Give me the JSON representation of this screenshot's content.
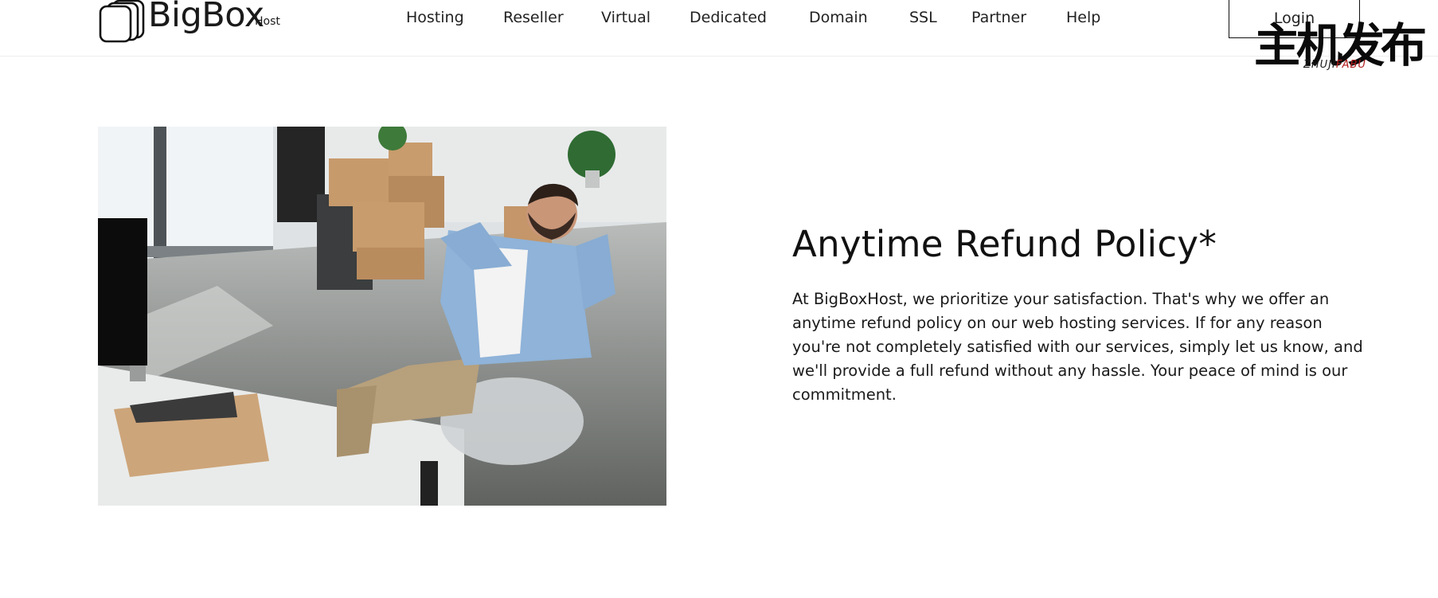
{
  "header": {
    "logo": {
      "name": "BigBox",
      "suffix": "Host",
      "icon": "stacked-boxes-logo"
    },
    "nav": [
      "Hosting",
      "Reseller",
      "Virtual",
      "Dedicated",
      "Domain",
      "SSL",
      "Partner",
      "Help"
    ],
    "login_label": "Login"
  },
  "watermark": {
    "han": "主机发布",
    "latin_prefix": "ZHUJI",
    "latin_accent": "FABU"
  },
  "hero": {
    "image": "man-relaxing-office-chair-photo",
    "title": "Anytime Refund Policy*",
    "description": "At BigBoxHost, we prioritize your satisfaction. That's why we offer an anytime refund policy on our web hosting services. If for any reason you're not completely satisfied with our services, simply let us know, and we'll provide a full refund without any hassle. Your peace of mind is our commitment."
  },
  "colors": {
    "text": "#111111",
    "background": "#ffffff",
    "accent": "#b11a1a",
    "shirt": "#8fb3d9"
  }
}
